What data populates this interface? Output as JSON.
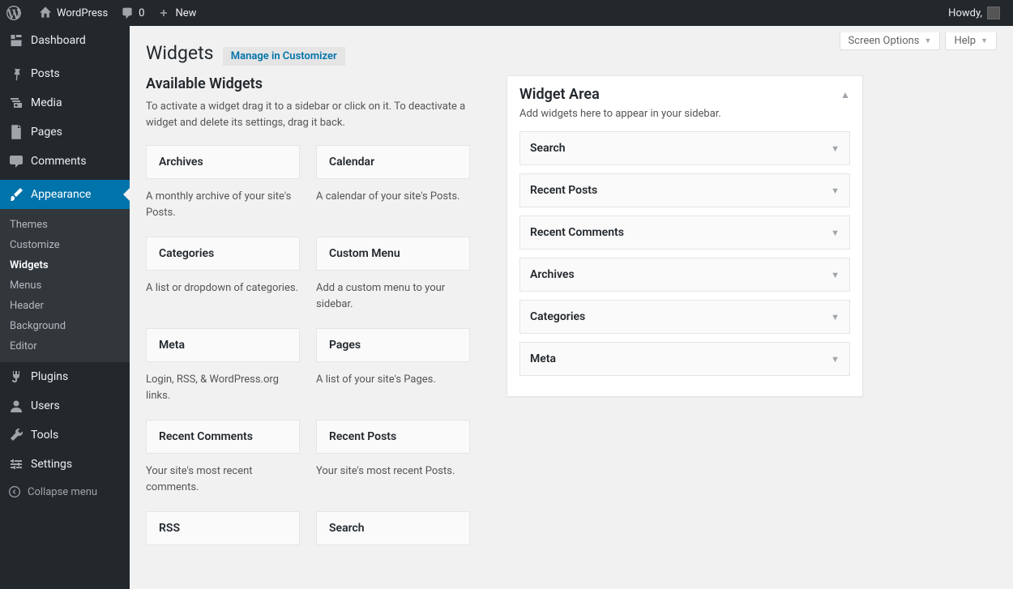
{
  "adminbar": {
    "site_name": "WordPress",
    "comments_count": "0",
    "new_label": "New",
    "howdy": "Howdy,"
  },
  "sidebar": {
    "items": [
      {
        "label": "Dashboard",
        "icon": "dashboard"
      },
      {
        "label": "Posts",
        "icon": "pin"
      },
      {
        "label": "Media",
        "icon": "media"
      },
      {
        "label": "Pages",
        "icon": "page"
      },
      {
        "label": "Comments",
        "icon": "comment"
      },
      {
        "label": "Appearance",
        "icon": "brush",
        "current": true
      },
      {
        "label": "Plugins",
        "icon": "plug"
      },
      {
        "label": "Users",
        "icon": "user"
      },
      {
        "label": "Tools",
        "icon": "wrench"
      },
      {
        "label": "Settings",
        "icon": "sliders"
      }
    ],
    "submenu": [
      {
        "label": "Themes"
      },
      {
        "label": "Customize"
      },
      {
        "label": "Widgets",
        "current": true
      },
      {
        "label": "Menus"
      },
      {
        "label": "Header"
      },
      {
        "label": "Background"
      },
      {
        "label": "Editor"
      }
    ],
    "collapse_label": "Collapse menu"
  },
  "screen": {
    "options_label": "Screen Options",
    "help_label": "Help"
  },
  "page": {
    "title": "Widgets",
    "manage_link": "Manage in Customizer",
    "available_title": "Available Widgets",
    "available_desc": "To activate a widget drag it to a sidebar or click on it. To deactivate a widget and delete its settings, drag it back."
  },
  "available_widgets": [
    {
      "title": "Archives",
      "desc": "A monthly archive of your site's Posts."
    },
    {
      "title": "Calendar",
      "desc": "A calendar of your site's Posts."
    },
    {
      "title": "Categories",
      "desc": "A list or dropdown of categories."
    },
    {
      "title": "Custom Menu",
      "desc": "Add a custom menu to your sidebar."
    },
    {
      "title": "Meta",
      "desc": "Login, RSS, & WordPress.org links."
    },
    {
      "title": "Pages",
      "desc": "A list of your site's Pages."
    },
    {
      "title": "Recent Comments",
      "desc": "Your site's most recent comments."
    },
    {
      "title": "Recent Posts",
      "desc": "Your site's most recent Posts."
    },
    {
      "title": "RSS",
      "desc": ""
    },
    {
      "title": "Search",
      "desc": ""
    }
  ],
  "widget_area": {
    "title": "Widget Area",
    "desc": "Add widgets here to appear in your sidebar.",
    "widgets": [
      {
        "title": "Search"
      },
      {
        "title": "Recent Posts"
      },
      {
        "title": "Recent Comments"
      },
      {
        "title": "Archives"
      },
      {
        "title": "Categories"
      },
      {
        "title": "Meta"
      }
    ]
  }
}
